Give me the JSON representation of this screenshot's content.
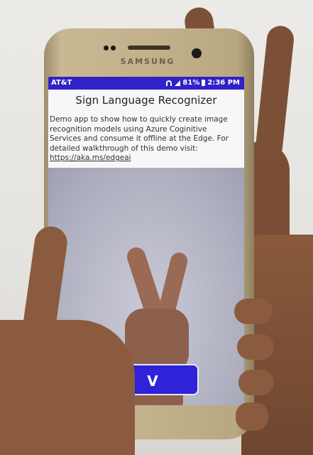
{
  "device": {
    "brand": "SAMSUNG"
  },
  "status_bar": {
    "carrier": "AT&T",
    "battery": "81%",
    "time": "2:36 PM"
  },
  "app": {
    "title": "Sign Language Recognizer",
    "description": "Demo app to show how to quickly create image recognition models using Azure Coginitive Services and consume it offline at the Edge. For detailed walkthrough of this demo visit:",
    "link": "https://aka.ms/edgeai"
  },
  "result": {
    "label": "V"
  },
  "colors": {
    "status_bar": "#2f22c7",
    "result_button": "#2f22d9",
    "header_background": "#f7f7f9"
  },
  "icons": [
    "wifi-icon",
    "signal-icon",
    "battery-icon"
  ]
}
